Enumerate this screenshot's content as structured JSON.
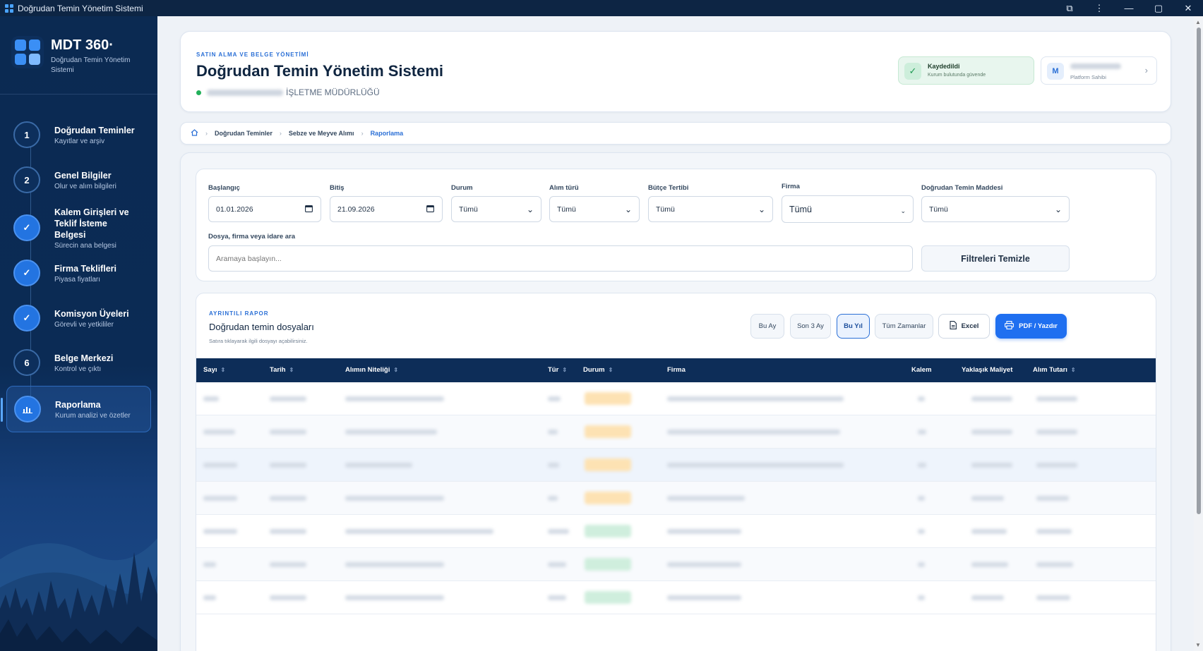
{
  "window": {
    "title": "Doğrudan Temin Yönetim Sistemi",
    "controls": [
      "⧉",
      "⋮",
      "—",
      "▢",
      "✕"
    ]
  },
  "sidebar": {
    "brand_name": "MDT 360·",
    "brand_sub": "Doğrudan Temin Yönetim Sistemi",
    "steps": [
      {
        "marker": "1",
        "state": "numbered",
        "title": "Doğrudan Teminler",
        "sub": "Kayıtlar ve arşiv"
      },
      {
        "marker": "2",
        "state": "numbered",
        "title": "Genel Bilgiler",
        "sub": "Olur ve alım bilgileri"
      },
      {
        "marker": "✓",
        "state": "done",
        "title": "Kalem Girişleri ve Teklif İsteme Belgesi",
        "sub": "Sürecin ana belgesi"
      },
      {
        "marker": "✓",
        "state": "done",
        "title": "Firma Teklifleri",
        "sub": "Piyasa fiyatları"
      },
      {
        "marker": "✓",
        "state": "done",
        "title": "Komisyon Üyeleri",
        "sub": "Görevli ve yetkililer"
      },
      {
        "marker": "6",
        "state": "numbered",
        "title": "Belge Merkezi",
        "sub": "Kontrol ve çıktı"
      },
      {
        "marker": "📊",
        "state": "active",
        "title": "Raporlama",
        "sub": "Kurum analizi ve özetler"
      }
    ]
  },
  "header": {
    "eyebrow": "SATIN ALMA VE BELGE YÖNETİMİ",
    "title": "Doğrudan Temin Yönetim Sistemi",
    "org_suffix": "İŞLETME MÜDÜRLÜĞÜ",
    "saved_title": "Kaydedildi",
    "saved_sub": "Kurum bulutunda güvende",
    "user_initial": "M",
    "user_role": "Platform Sahibi"
  },
  "breadcrumb": {
    "items": [
      "Doğrudan Teminler",
      "Sebze ve Meyve Alımı",
      "Raporlama"
    ]
  },
  "filters": {
    "start_label": "Başlangıç",
    "start_value": "01.01.2026",
    "end_label": "Bitiş",
    "end_value": "21.09.2026",
    "status_label": "Durum",
    "status_value": "Tümü",
    "type_label": "Alım türü",
    "type_value": "Tümü",
    "budget_label": "Bütçe Tertibi",
    "budget_value": "Tümü",
    "firm_label": "Firma",
    "firm_value": "Tümü",
    "article_label": "Doğrudan Temin Maddesi",
    "article_value": "Tümü",
    "search_label": "Dosya, firma veya idare ara",
    "search_placeholder": "Aramaya başlayın...",
    "clear_label": "Filtreleri Temizle"
  },
  "report": {
    "eyebrow": "AYRINTILI RAPOR",
    "title": "Doğrudan temin dosyaları",
    "hint": "Satıra tıklayarak ilgili dosyayı açabilirsiniz.",
    "ranges": [
      "Bu Ay",
      "Son 3 Ay",
      "Bu Yıl",
      "Tüm Zamanlar"
    ],
    "active_range": "Bu Yıl",
    "excel_label": "Excel",
    "pdf_label": "PDF / Yazdır",
    "columns": [
      "Sayı",
      "Tarih",
      "Alımın Niteliği",
      "Tür",
      "Durum",
      "Firma",
      "Kalem",
      "Yaklaşık Maliyet",
      "Alım Tutarı"
    ]
  },
  "colors": {
    "sidebar_bg": "#0b2a52",
    "accent": "#1f6ff0",
    "table_header": "#0d2d58",
    "success": "#22b05a",
    "warning_pill": "#fde2b3",
    "success_pill": "#cfeedd"
  }
}
